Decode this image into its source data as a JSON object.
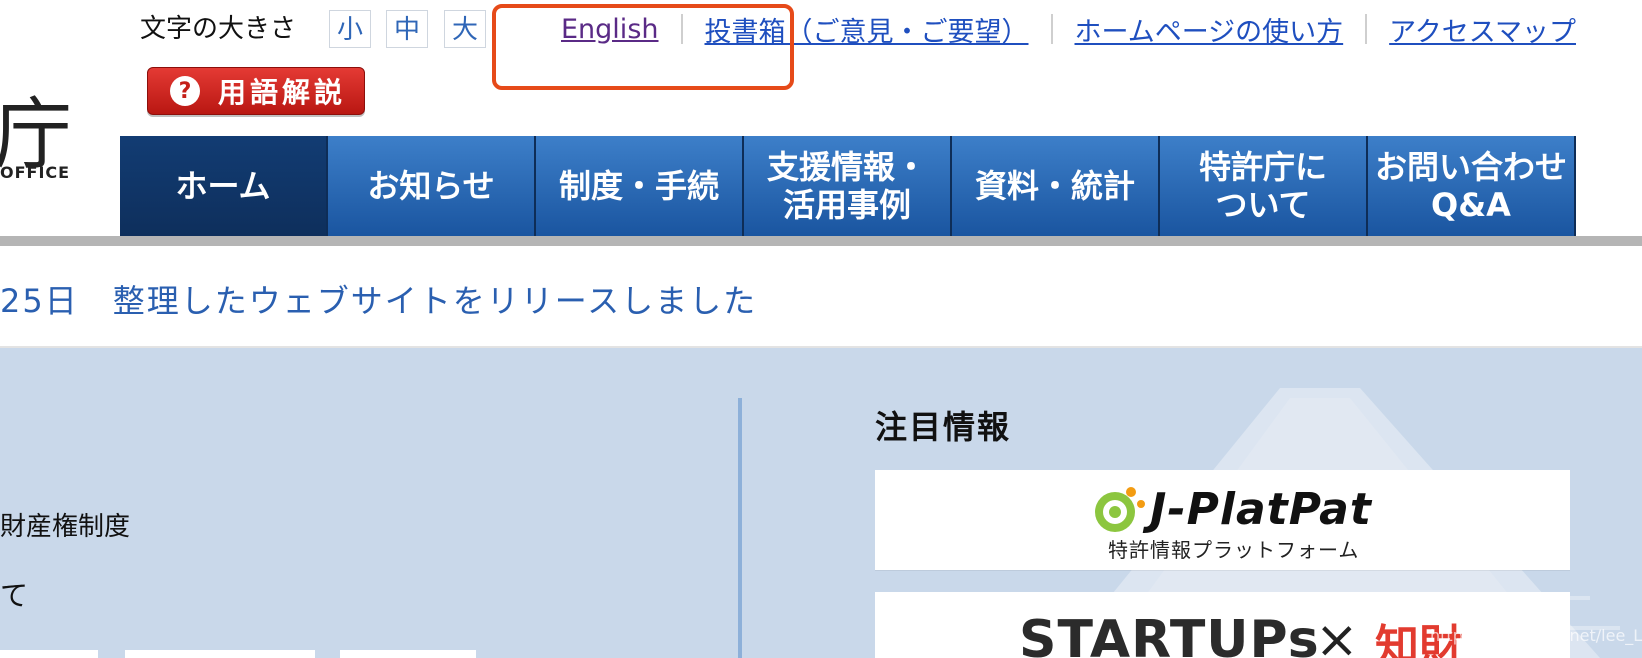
{
  "header": {
    "font_size_label": "文字の大きさ",
    "font_sizes": [
      "小",
      "中",
      "大"
    ],
    "top_links": [
      {
        "label": "English",
        "visited": true
      },
      {
        "label": "投書箱（ご意見・ご要望）",
        "visited": false
      },
      {
        "label": "ホームページの使い方",
        "visited": false
      },
      {
        "label": "アクセスマップ",
        "visited": false
      }
    ],
    "logo": {
      "char": "庁",
      "office_text": "OFFICE"
    },
    "glossary_button": {
      "label": "用語解説",
      "icon": "help-icon"
    }
  },
  "nav": {
    "items": [
      {
        "label": "ホーム",
        "active": true
      },
      {
        "label": "お知らせ"
      },
      {
        "label": "制度・手続"
      },
      {
        "label_lines": [
          "支援情報・",
          "活用事例"
        ]
      },
      {
        "label": "資料・統計"
      },
      {
        "label_lines": [
          "特許庁に",
          "ついて"
        ]
      },
      {
        "label_lines": [
          "お問い合わせ",
          "Q&A"
        ]
      }
    ]
  },
  "news": {
    "text": "25日　整理したウェブサイトをリリースしました"
  },
  "content": {
    "left_text": "財産権制度",
    "left_fragment": "て",
    "featured": {
      "title": "注目情報",
      "cards": [
        {
          "name": "J-PlatPat",
          "title": "J-PlatPat",
          "subtitle": "特許情報プラットフォーム"
        },
        {
          "name": "STARTUPs",
          "title": "STARTUPs",
          "suffix": "知財"
        }
      ]
    }
  },
  "footer": {
    "watermark": "https://blog.csdn.net/lee_LLL"
  },
  "colors": {
    "nav_blue": "#1a55a0",
    "nav_active": "#123c73",
    "link_blue": "#1f4fbf",
    "visited_purple": "#5a2a86",
    "highlight": "#e64a19",
    "panel_bg": "#c9d8ea"
  }
}
